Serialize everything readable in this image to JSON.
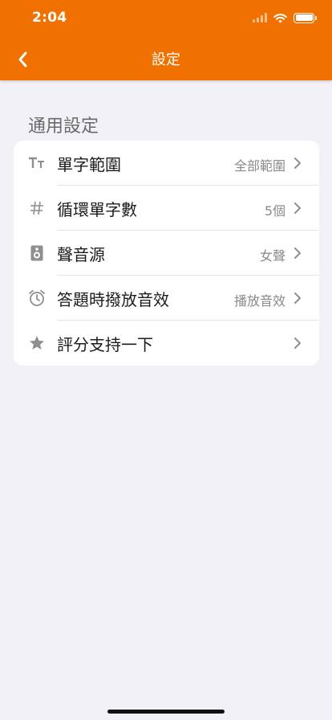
{
  "status_bar": {
    "time": "2:04"
  },
  "nav": {
    "title": "設定"
  },
  "section": {
    "title": "通用設定"
  },
  "rows": [
    {
      "label": "單字範圍",
      "value": "全部範圍",
      "icon": "text-size-icon"
    },
    {
      "label": "循環單字數",
      "value": "5個",
      "icon": "hash-icon"
    },
    {
      "label": "聲音源",
      "value": "女聲",
      "icon": "speaker-icon"
    },
    {
      "label": "答題時撥放音效",
      "value": "播放音效",
      "icon": "alarm-clock-icon"
    },
    {
      "label": "評分支持一下",
      "value": "",
      "icon": "star-icon"
    }
  ],
  "colors": {
    "accent": "#f07000",
    "background": "#f2f1f7",
    "icon_gray": "#8e8e93"
  }
}
